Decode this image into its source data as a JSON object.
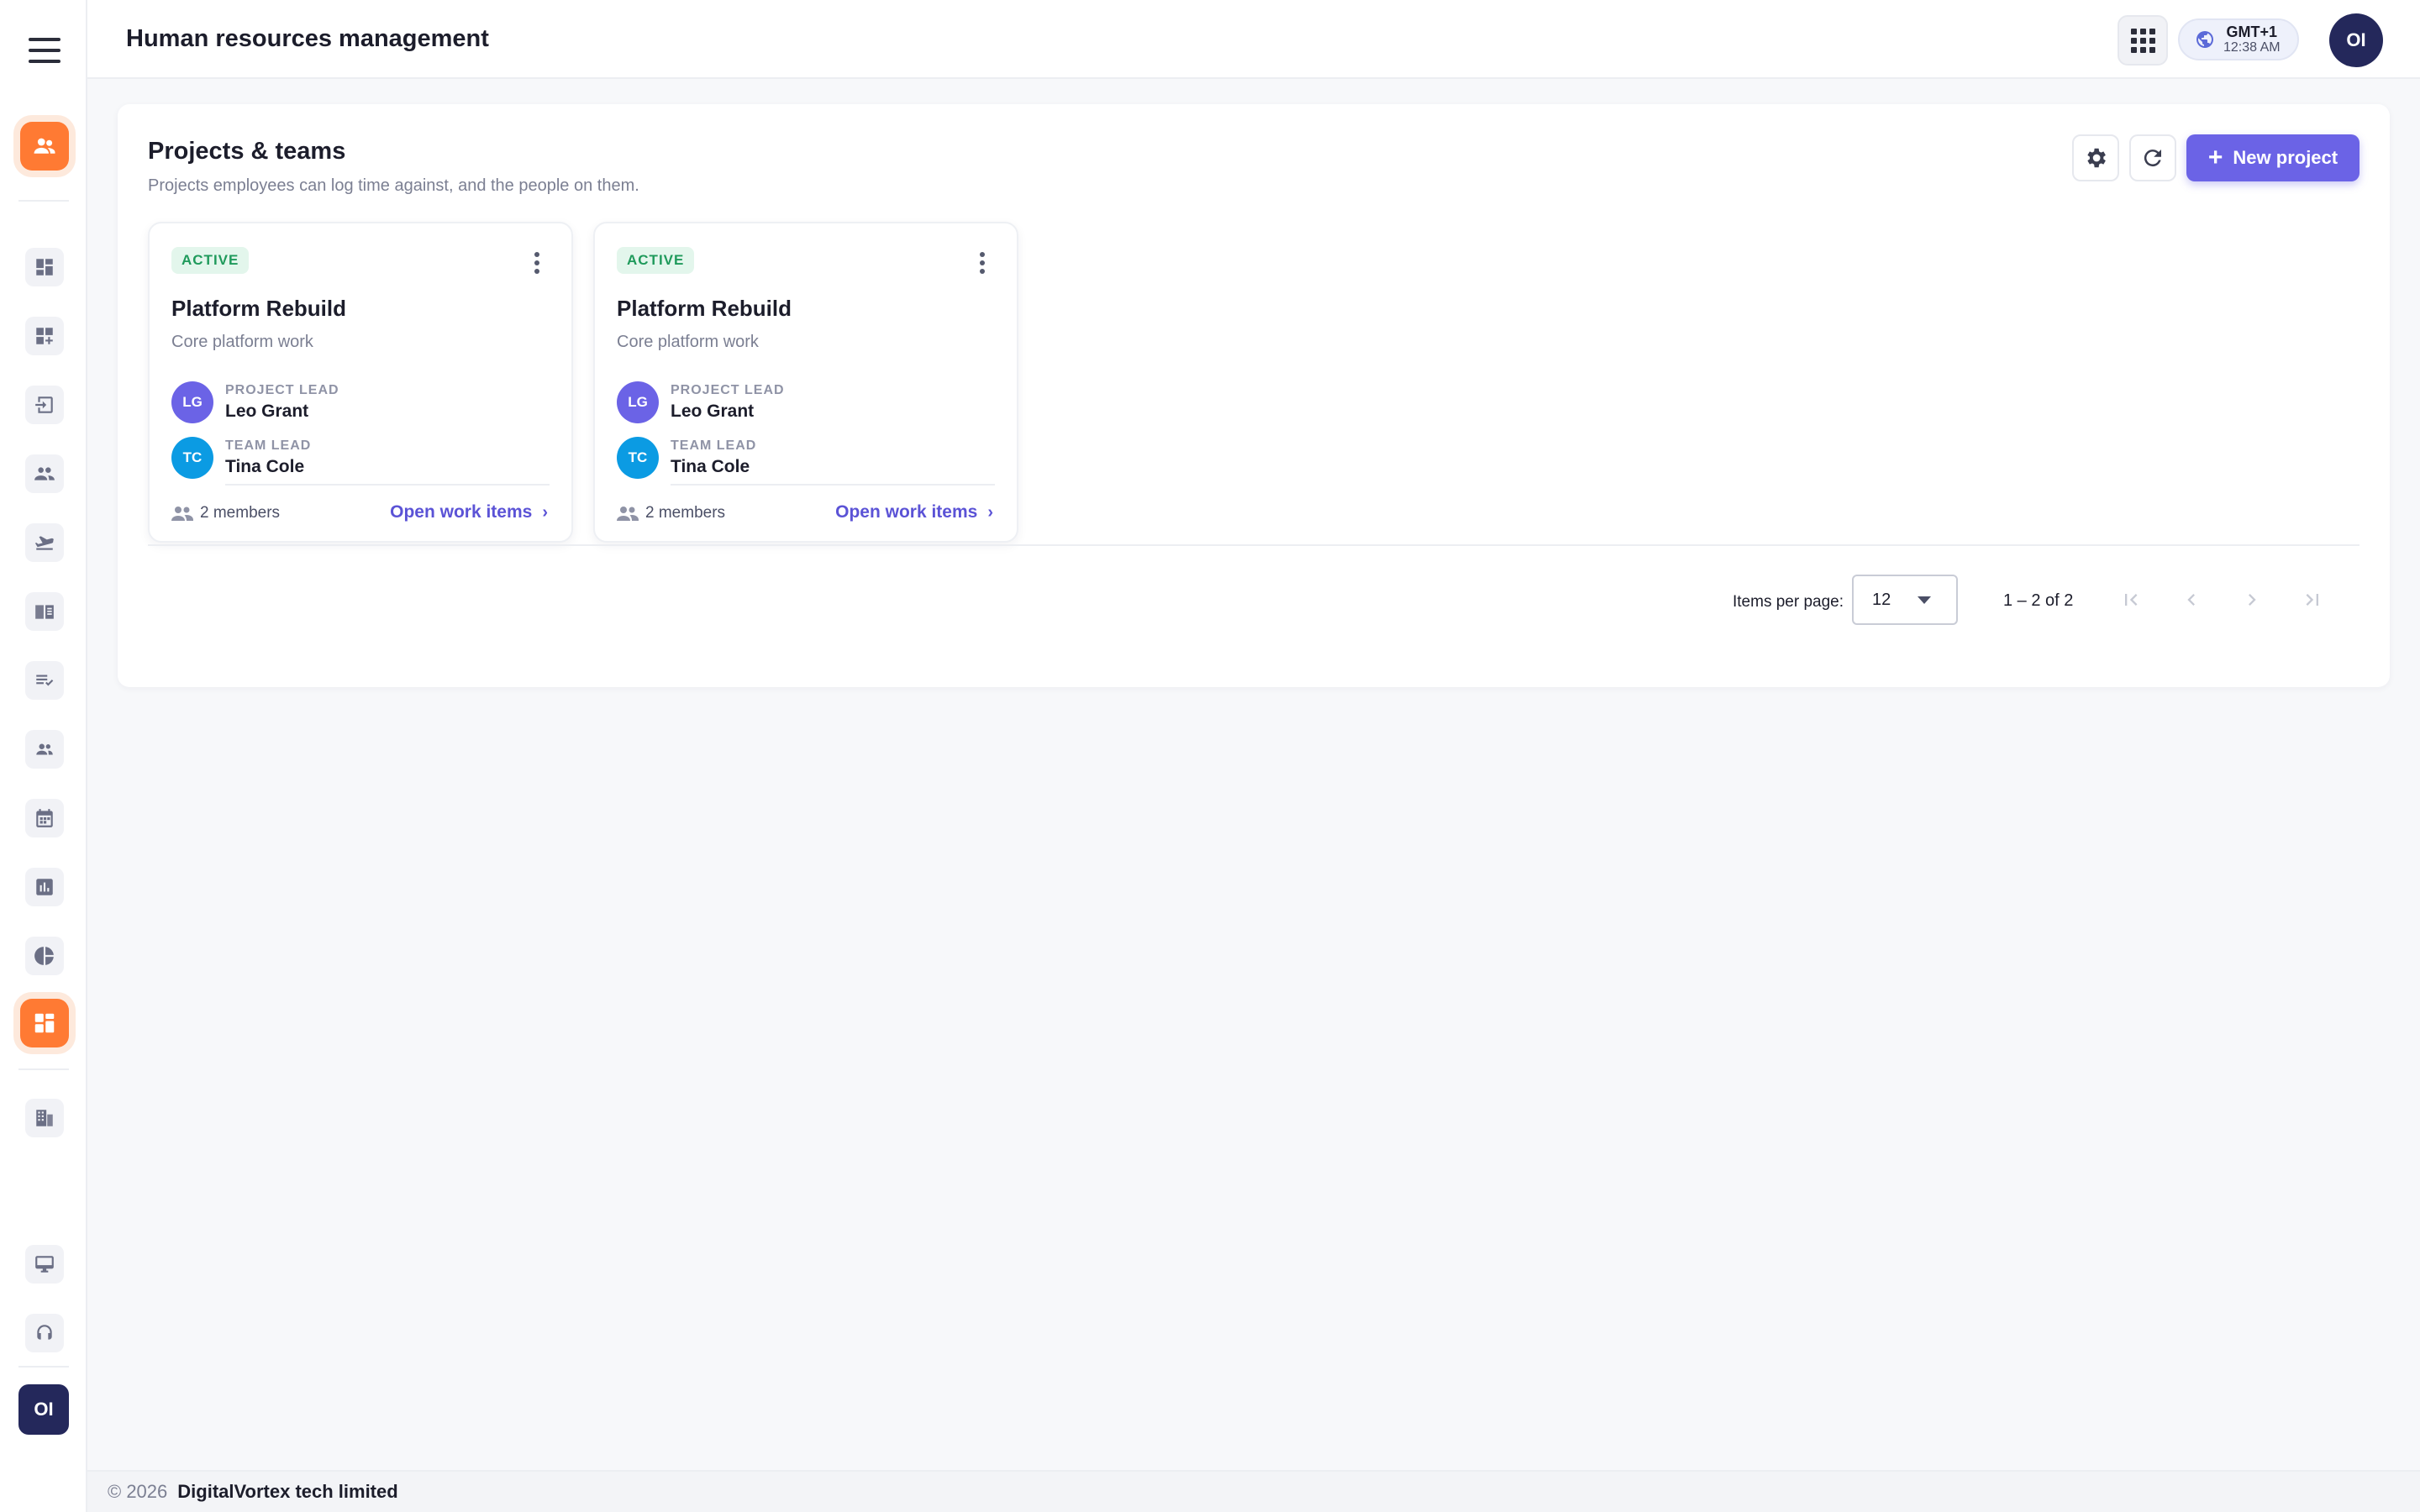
{
  "header": {
    "title": "Human resources management",
    "timezone": "GMT+1",
    "time": "12:38 AM",
    "user_initials": "OI"
  },
  "sidebar": {
    "items": [
      {
        "icon": "people-icon",
        "highlighted": true
      },
      {
        "icon": "dashboard-icon"
      },
      {
        "icon": "dashboard-add-icon"
      },
      {
        "icon": "input-icon"
      },
      {
        "icon": "group-icon"
      },
      {
        "icon": "flight-takeoff-icon"
      },
      {
        "icon": "book-icon"
      },
      {
        "icon": "playlist-check-icon"
      },
      {
        "icon": "team-icon"
      },
      {
        "icon": "calendar-icon"
      },
      {
        "icon": "bar-chart-icon"
      },
      {
        "icon": "pie-chart-icon"
      },
      {
        "icon": "projects-icon",
        "highlighted": true
      },
      {
        "icon": "building-icon"
      },
      {
        "icon": "desktop-icon"
      },
      {
        "icon": "support-icon"
      }
    ],
    "user_initials": "OI"
  },
  "page": {
    "title": "Projects & teams",
    "subtitle": "Projects employees can log time against, and the people on them.",
    "new_button": "New project",
    "settings_icon": "gear-icon",
    "refresh_icon": "refresh-icon"
  },
  "projects": [
    {
      "status": "ACTIVE",
      "name": "Platform Rebuild",
      "description": "Core platform work",
      "lead_role": "PROJECT LEAD",
      "lead_initials": "LG",
      "lead_name": "Leo Grant",
      "team_role": "TEAM LEAD",
      "team_initials": "TC",
      "team_name": "Tina Cole",
      "members": "2 members",
      "link": "Open work items"
    },
    {
      "status": "ACTIVE",
      "name": "Platform Rebuild",
      "description": "Core platform work",
      "lead_role": "PROJECT LEAD",
      "lead_initials": "LG",
      "lead_name": "Leo Grant",
      "team_role": "TEAM LEAD",
      "team_initials": "TC",
      "team_name": "Tina Cole",
      "members": "2 members",
      "link": "Open work items"
    }
  ],
  "pagination": {
    "label": "Items per page:",
    "per_page": "12",
    "range": "1 – 2 of 2"
  },
  "footer": {
    "copyright": "© 2026",
    "company": "DigitalVortex tech limited"
  },
  "colors": {
    "accent": "#6b63e6",
    "highlight": "#ff7a33",
    "active_badge": "#1f9a5b",
    "avatar_dark": "#24285b"
  }
}
